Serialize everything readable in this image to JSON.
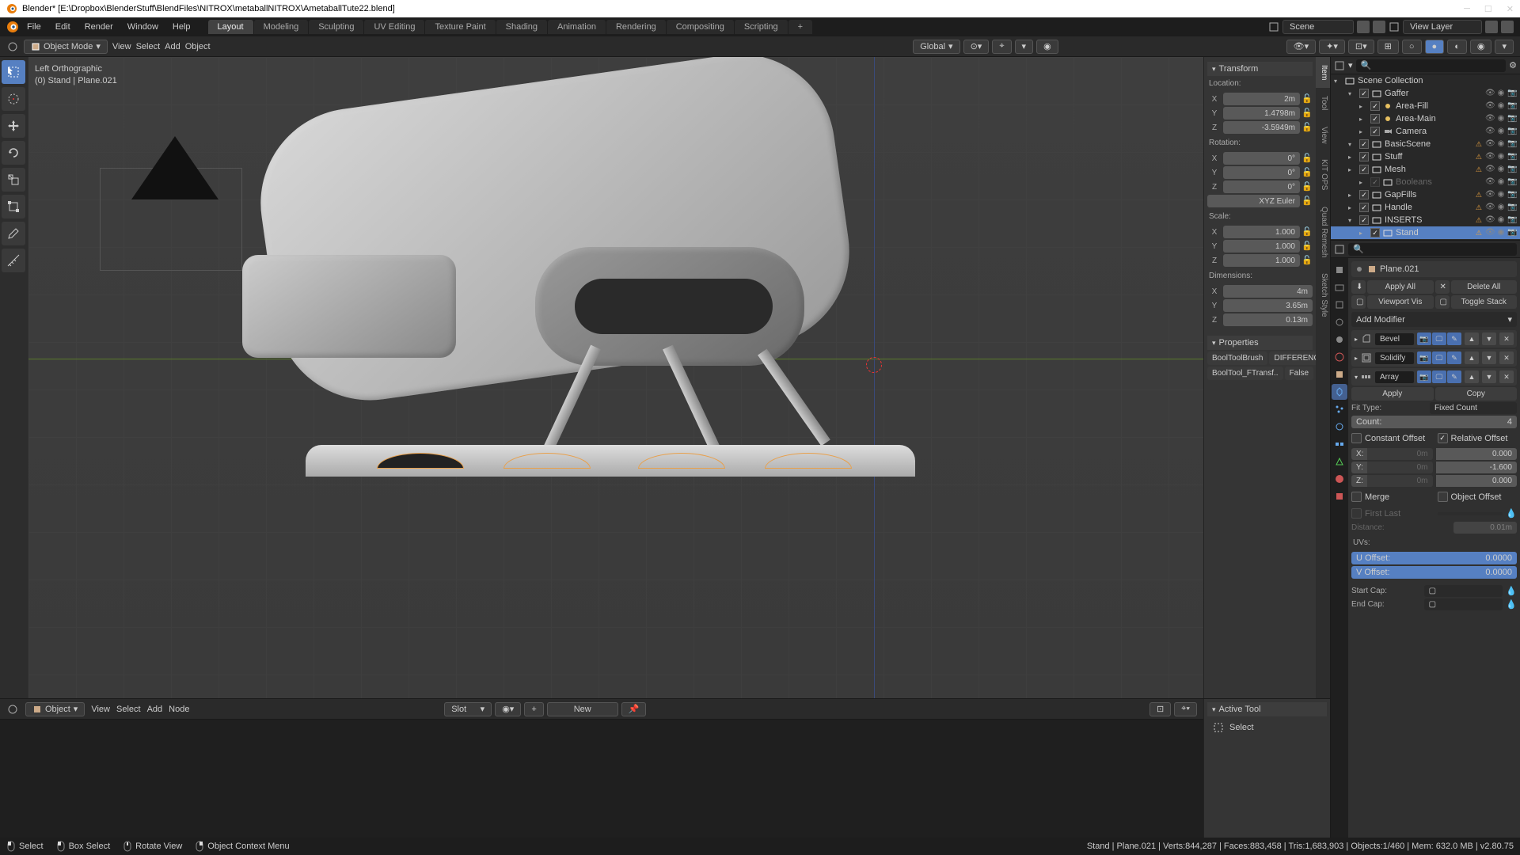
{
  "window": {
    "title": "Blender* [E:\\Dropbox\\BlenderStuff\\BlendFiles\\NITROX\\metaballNITROX\\AmetaballTute22.blend]"
  },
  "topmenu": {
    "items": [
      "File",
      "Edit",
      "Render",
      "Window",
      "Help"
    ],
    "workspaces": [
      "Layout",
      "Modeling",
      "Sculpting",
      "UV Editing",
      "Texture Paint",
      "Shading",
      "Animation",
      "Rendering",
      "Compositing",
      "Scripting"
    ],
    "scene": "Scene",
    "view_layer": "View Layer"
  },
  "header": {
    "mode": "Object Mode",
    "menus": [
      "View",
      "Select",
      "Add",
      "Object"
    ],
    "orientation": "Global"
  },
  "viewport": {
    "label": "Left Orthographic",
    "sub": "(0) Stand | Plane.021"
  },
  "npanel": {
    "tabs": [
      "Item",
      "Tool",
      "View",
      "KIT OPS",
      "Quad Remesh",
      "Sketch Style"
    ],
    "transform": {
      "title": "Transform",
      "loc_label": "Location:",
      "loc": {
        "x": "2m",
        "y": "1.4798m",
        "z": "-3.5949m"
      },
      "rot_label": "Rotation:",
      "rot": {
        "x": "0°",
        "y": "0°",
        "z": "0°"
      },
      "rot_mode": "XYZ Euler",
      "scale_label": "Scale:",
      "scale": {
        "x": "1.000",
        "y": "1.000",
        "z": "1.000"
      },
      "dim_label": "Dimensions:",
      "dim": {
        "x": "4m",
        "y": "3.65m",
        "z": "0.13m"
      }
    },
    "properties": {
      "title": "Properties",
      "booltool_brush": "BoolToolBrush",
      "booltool_brush_val": "DIFFERENCE",
      "booltool_ftransf": "BoolTool_FTransf..",
      "booltool_ftransf_val": "False"
    }
  },
  "outliner": {
    "scene_collection": "Scene Collection",
    "rows": [
      {
        "indent": 1,
        "expand": true,
        "name": "Gaffer"
      },
      {
        "indent": 2,
        "expand": false,
        "name": "Area-Fill",
        "light": true
      },
      {
        "indent": 2,
        "expand": false,
        "name": "Area-Main",
        "light": true
      },
      {
        "indent": 2,
        "expand": false,
        "name": "Camera",
        "cam": true
      },
      {
        "indent": 1,
        "expand": true,
        "name": "BasicScene",
        "warn": true
      },
      {
        "indent": 1,
        "expand": false,
        "name": "Stuff",
        "warn": true
      },
      {
        "indent": 1,
        "expand": false,
        "name": "Mesh",
        "warn": true
      },
      {
        "indent": 2,
        "expand": false,
        "name": "Booleans",
        "dim": true
      },
      {
        "indent": 1,
        "expand": false,
        "name": "GapFills",
        "warn": true
      },
      {
        "indent": 1,
        "expand": false,
        "name": "Handle",
        "warn": true
      },
      {
        "indent": 1,
        "expand": true,
        "name": "INSERTS",
        "warn": true
      },
      {
        "indent": 2,
        "expand": false,
        "name": "Stand",
        "warn": true,
        "selected": true
      }
    ]
  },
  "properties": {
    "obj_name": "Plane.021",
    "apply_all": "Apply All",
    "delete_all": "Delete All",
    "viewport_vis": "Viewport Vis",
    "toggle_stack": "Toggle Stack",
    "add_modifier": "Add Modifier",
    "modifiers": [
      "Bevel",
      "Solidify",
      "Array"
    ],
    "array": {
      "apply": "Apply",
      "copy": "Copy",
      "fit_type_label": "Fit Type:",
      "fit_type": "Fixed Count",
      "count_label": "Count:",
      "count": "4",
      "const_offset": "Constant Offset",
      "rel_offset": "Relative Offset",
      "const": {
        "x": "0m",
        "y": "0m",
        "z": "0m"
      },
      "rel": {
        "x": "0.000",
        "y": "-1.600",
        "z": "0.000"
      },
      "merge": "Merge",
      "obj_offset": "Object Offset",
      "first_last": "First Last",
      "distance_label": "Distance:",
      "distance": "0.01m",
      "uvs_label": "UVs:",
      "u_offset_label": "U Offset:",
      "u_offset": "0.0000",
      "v_offset_label": "V Offset:",
      "v_offset": "0.0000",
      "start_cap": "Start Cap:",
      "end_cap": "End Cap:"
    }
  },
  "node_editor": {
    "type": "Object",
    "menus": [
      "View",
      "Select",
      "Add",
      "Node"
    ],
    "slot": "Slot",
    "new": "New"
  },
  "active_tool": {
    "title": "Active Tool",
    "tool": "Select"
  },
  "statusbar": {
    "select": "Select",
    "box_select": "Box Select",
    "rotate": "Rotate View",
    "context_menu": "Object Context Menu",
    "stats": "Stand | Plane.021 | Verts:844,287 | Faces:883,458 | Tris:1,683,903 | Objects:1/460 | Mem: 632.0 MB | v2.80.75"
  }
}
